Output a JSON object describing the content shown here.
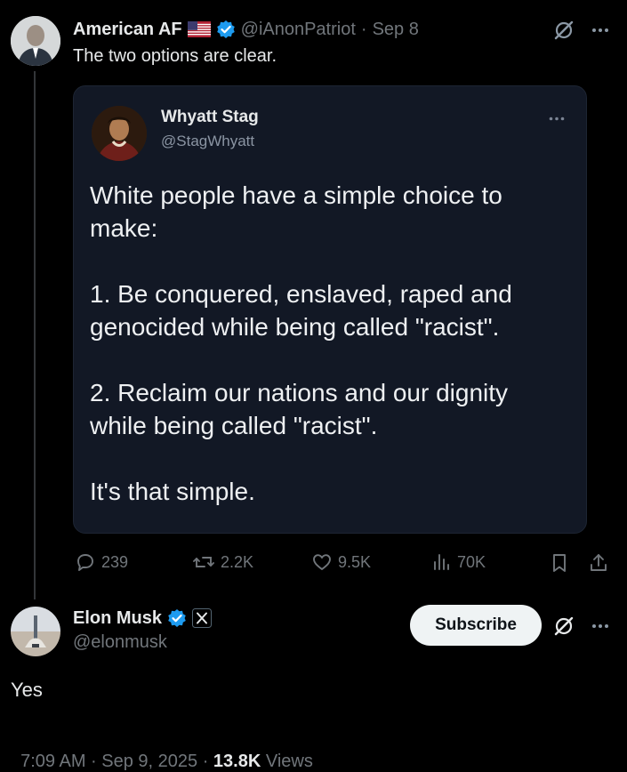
{
  "original_post": {
    "author_name": "American AF",
    "flag_icon": "us-flag-icon",
    "handle": "@iAnonPatriot",
    "separator": "·",
    "date": "Sep 8",
    "text": "The two options are clear.",
    "quoted": {
      "author_name": "Whyatt Stag",
      "handle": "@StagWhyatt",
      "text": "White people have a simple choice to make:\n\n1. Be conquered, enslaved, raped and genocided while being called \"racist\".\n\n2. Reclaim our nations and our dignity while being called \"racist\".\n\nIt's that simple."
    },
    "actions": {
      "replies": "239",
      "reposts": "2.2K",
      "likes": "9.5K",
      "views": "70K"
    }
  },
  "main_post": {
    "author_name": "Elon Musk",
    "handle": "@elonmusk",
    "subscribe_label": "Subscribe",
    "text": "Yes",
    "timestamp": "7:09 AM · Sep 9, 2025 · ",
    "views_count": "13.8K",
    "views_label": " Views"
  },
  "colors": {
    "background": "#000000",
    "verified_blue": "#1d9bf0",
    "muted": "#71767b",
    "card": "#121825"
  }
}
